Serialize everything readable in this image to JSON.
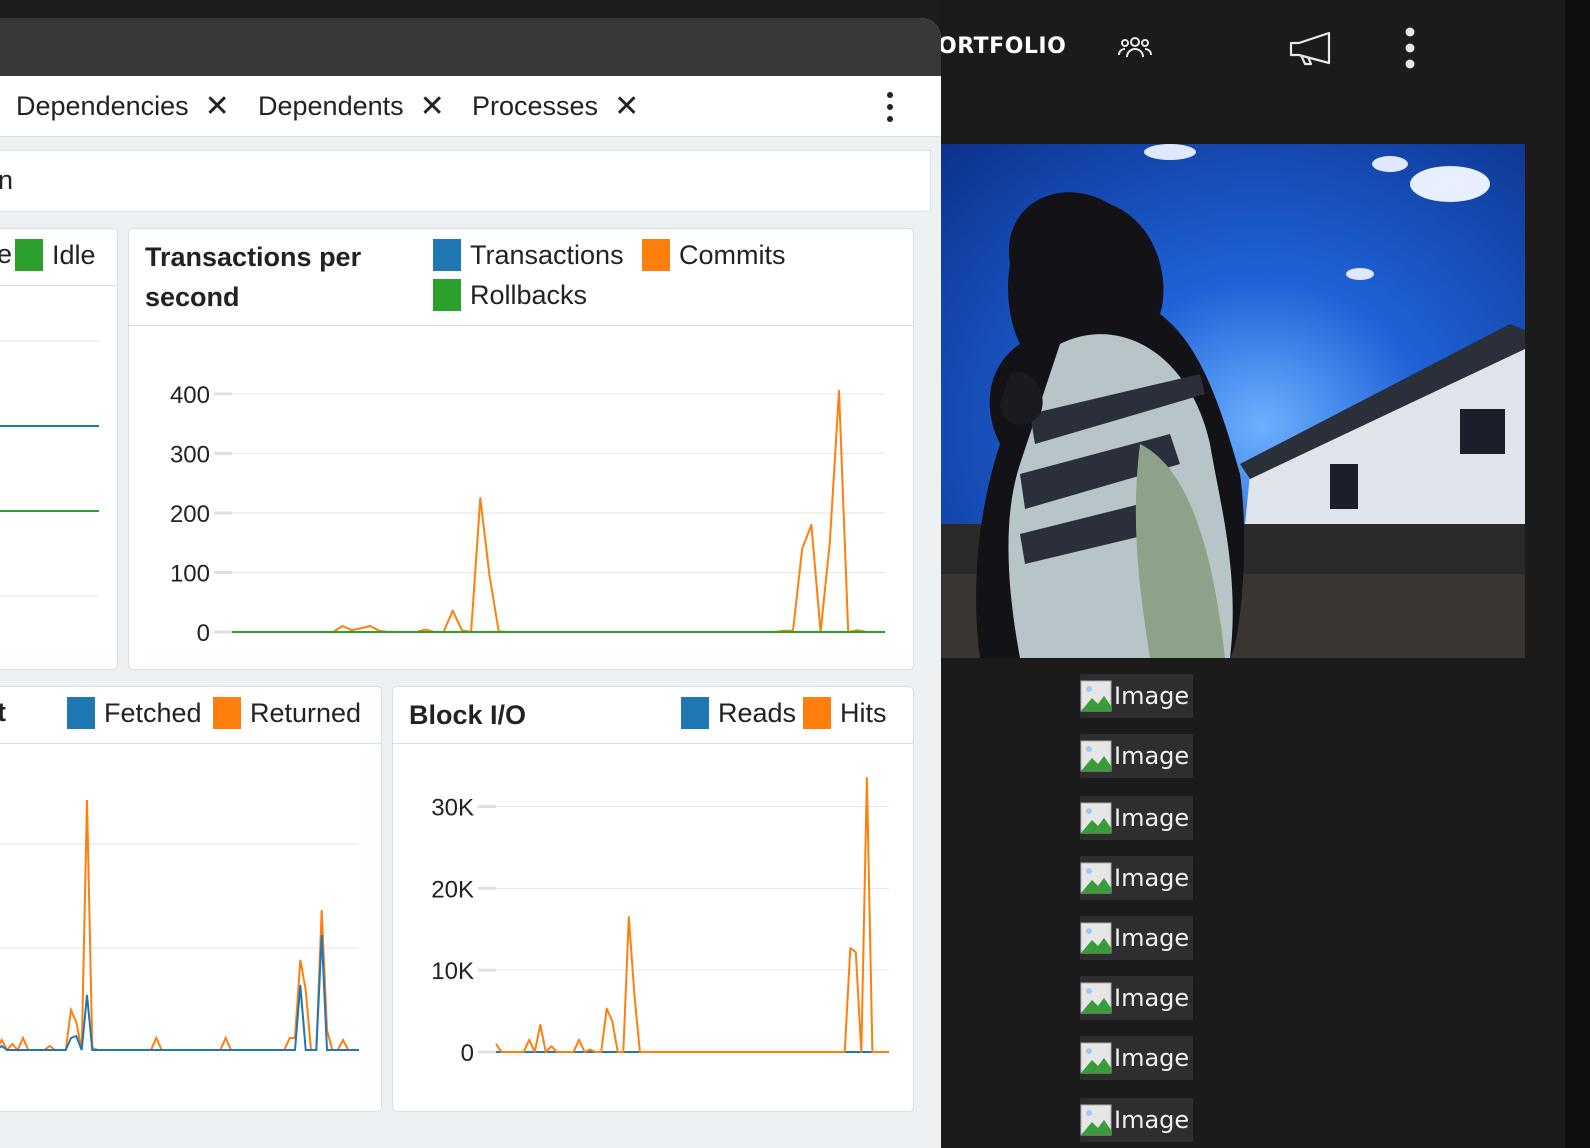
{
  "window": {
    "tabs": [
      {
        "label": "Dependencies",
        "close": "✕"
      },
      {
        "label": "Dependents",
        "close": "✕"
      },
      {
        "label": "Processes",
        "close": "✕"
      }
    ],
    "toolbar_fragment": "n"
  },
  "panels": {
    "sessions": {
      "legend_fragment": "e",
      "legend": [
        {
          "name": "Idle",
          "color": "#2ca02c"
        }
      ]
    },
    "tps": {
      "title": "Transactions per second",
      "legend": [
        {
          "name": "Transactions",
          "color": "#1f77b4"
        },
        {
          "name": "Commits",
          "color": "#ff7f0e"
        },
        {
          "name": "Rollbacks",
          "color": "#2ca02c"
        }
      ]
    },
    "tuples_out": {
      "title_fragment": "t",
      "legend": [
        {
          "name": "Fetched",
          "color": "#1f77b4"
        },
        {
          "name": "Returned",
          "color": "#ff7f0e"
        }
      ]
    },
    "block_io": {
      "title": "Block I/O",
      "legend": [
        {
          "name": "Reads",
          "color": "#1f77b4"
        },
        {
          "name": "Hits",
          "color": "#ff7f0e"
        }
      ]
    }
  },
  "chart_data": [
    {
      "type": "line",
      "title": "",
      "series": [
        {
          "name": "Idle",
          "values": [
            null
          ]
        }
      ],
      "grid": true
    },
    {
      "type": "line",
      "title": "Transactions per second",
      "ylim": [
        0,
        420
      ],
      "yticks": [
        "400",
        "300",
        "200",
        "100",
        "0"
      ],
      "ytick_values": [
        400,
        300,
        200,
        100,
        0
      ],
      "series": [
        {
          "name": "Transactions",
          "values": [
            0,
            0,
            0,
            0,
            0,
            0,
            0,
            0,
            0,
            0,
            0,
            0,
            0,
            0,
            0,
            0,
            0,
            0,
            0,
            0,
            0,
            0,
            0,
            0,
            0,
            0,
            0,
            0,
            0,
            0,
            0,
            0,
            0,
            0,
            0,
            0,
            0,
            0,
            0,
            0,
            0,
            0,
            0,
            0,
            0,
            0,
            0,
            0,
            0,
            0,
            0,
            0,
            0,
            0,
            0,
            0,
            0,
            0,
            0,
            0,
            0,
            0,
            0,
            0,
            0,
            0
          ]
        },
        {
          "name": "Commits",
          "values": [
            0,
            0,
            0,
            0,
            0,
            0,
            0,
            0,
            0,
            0,
            0,
            0,
            10,
            3,
            6,
            10,
            2,
            0,
            0,
            0,
            0,
            4,
            0,
            0,
            36,
            3,
            0,
            225,
            95,
            1,
            0,
            0,
            0,
            0,
            0,
            0,
            0,
            0,
            0,
            0,
            0,
            0,
            0,
            0,
            0,
            0,
            0,
            0,
            0,
            0,
            0,
            0,
            0,
            0,
            0,
            0,
            0,
            0,
            0,
            0,
            2,
            2,
            140,
            180,
            0,
            150,
            405,
            0,
            3,
            0,
            0,
            0
          ]
        },
        {
          "name": "Rollbacks",
          "values": [
            0,
            0,
            0,
            0,
            0,
            0,
            0,
            0,
            0,
            0,
            0,
            0,
            0,
            0,
            0,
            0,
            0,
            0,
            0,
            0,
            0,
            0,
            0,
            0,
            0,
            0,
            0,
            0,
            0,
            0,
            0,
            0,
            0,
            0,
            0,
            0,
            0,
            0,
            0,
            0,
            0,
            0,
            0,
            0,
            0,
            0,
            0,
            0,
            0,
            0,
            0,
            0,
            0,
            0,
            0,
            0,
            0,
            0,
            0,
            0,
            0,
            0,
            0,
            0,
            0,
            0
          ]
        }
      ],
      "grid": true
    },
    {
      "type": "line",
      "title": "",
      "series": [
        {
          "name": "Fetched",
          "values": [
            0,
            2,
            0,
            1,
            0,
            0,
            0,
            0,
            0,
            1,
            0,
            0,
            0,
            0,
            0,
            0,
            0,
            0,
            0,
            0,
            0,
            0,
            0,
            0,
            0,
            0,
            0,
            0,
            0,
            0,
            0,
            0,
            0,
            0,
            0,
            0,
            0,
            0,
            0,
            0,
            0,
            0,
            0,
            0,
            0,
            0,
            0,
            0,
            0,
            0,
            0,
            0,
            0,
            0,
            0,
            0,
            0,
            0,
            0,
            0,
            0,
            0,
            0,
            0,
            0
          ]
        },
        {
          "name": "Returned",
          "values": [
            0,
            3,
            0,
            3,
            0,
            0,
            0,
            0,
            0,
            3,
            0,
            0,
            0,
            0,
            0,
            0,
            0,
            0,
            0,
            0,
            0,
            0,
            0,
            0,
            0,
            0,
            0,
            0,
            0,
            0,
            0,
            0,
            0,
            0,
            0,
            0,
            0,
            0,
            0,
            0,
            0,
            0,
            0,
            0,
            0,
            0,
            0,
            0,
            0,
            0,
            0,
            0,
            0,
            0,
            0,
            0,
            0,
            0,
            0,
            0,
            0,
            0,
            0,
            0,
            0
          ]
        }
      ],
      "grid": true
    },
    {
      "type": "line",
      "title": "Block I/O",
      "ylim": [
        0,
        33000
      ],
      "yticks": [
        "30K",
        "20K",
        "10K",
        "0"
      ],
      "ytick_values": [
        30000,
        20000,
        10000,
        0
      ],
      "series": [
        {
          "name": "Reads",
          "values": [
            0,
            0,
            0,
            0,
            0,
            0,
            0,
            0,
            0,
            0,
            0,
            0,
            0,
            0,
            0,
            0,
            0,
            0,
            0,
            0,
            0,
            0,
            0,
            0,
            0,
            0,
            0,
            0,
            0,
            0,
            0,
            0,
            0,
            0,
            0,
            0,
            0,
            0,
            0,
            0,
            0,
            0,
            0,
            0,
            0,
            0,
            0,
            0,
            0,
            0,
            0,
            0,
            0,
            0,
            0,
            0,
            0,
            0,
            0,
            0,
            0,
            0,
            0,
            0,
            0,
            0
          ]
        },
        {
          "name": "Hits",
          "values": [
            1000,
            0,
            0,
            0,
            0,
            0,
            1500,
            0,
            3300,
            0,
            700,
            0,
            0,
            0,
            0,
            1500,
            0,
            300,
            0,
            0,
            5300,
            3800,
            0,
            0,
            16500,
            7000,
            0,
            0,
            0,
            0,
            0,
            0,
            0,
            0,
            0,
            0,
            0,
            0,
            0,
            0,
            0,
            0,
            0,
            0,
            0,
            0,
            0,
            0,
            0,
            0,
            0,
            0,
            0,
            0,
            0,
            0,
            0,
            0,
            0,
            0,
            0,
            0,
            0,
            0,
            12700,
            12200,
            0,
            33500,
            0,
            0,
            0,
            0
          ]
        }
      ],
      "grid": true
    }
  ],
  "site": {
    "brand": "ORTFOLIO",
    "icons": [
      "group-icon",
      "megaphone-icon",
      "more-vertical-icon"
    ],
    "image_items": [
      "Image",
      "Image",
      "Image",
      "Image",
      "Image",
      "Image",
      "Image",
      "Image"
    ]
  }
}
